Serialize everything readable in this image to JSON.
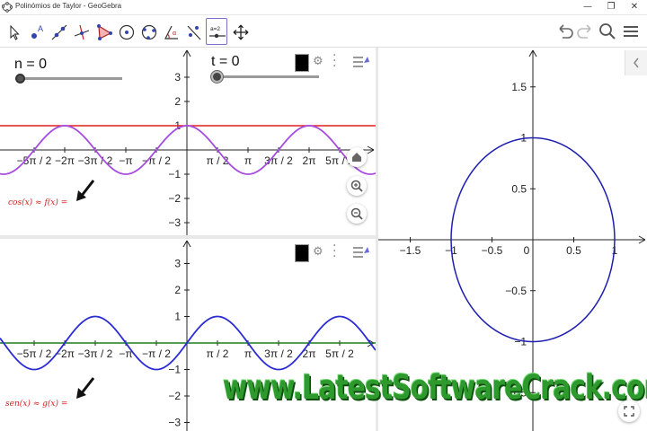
{
  "window": {
    "title": "Polinómios de Taylor - GeoGebra",
    "minimize_glyph": "—",
    "restore_glyph": "❐",
    "close_glyph": "✕"
  },
  "toolbar": {
    "tools": [
      {
        "name": "move-tool-icon"
      },
      {
        "name": "point-tool-icon"
      },
      {
        "name": "line-tool-icon"
      },
      {
        "name": "perpendicular-tool-icon"
      },
      {
        "name": "polygon-tool-icon"
      },
      {
        "name": "circle-tool-icon"
      },
      {
        "name": "conic-tool-icon"
      },
      {
        "name": "angle-tool-icon"
      },
      {
        "name": "reflect-tool-icon"
      },
      {
        "name": "slider-tool-icon",
        "label": "a=2",
        "active": true
      },
      {
        "name": "move-graphics-view-icon"
      }
    ],
    "right": [
      "undo-icon",
      "redo-icon",
      "search-icon",
      "menu-icon"
    ]
  },
  "graphics1": {
    "slider_n_label": "n = 0",
    "slider_t_label": "t = 0",
    "formula": "cos(x) ≈ f(x) =",
    "y_ticks": [
      "3",
      "2",
      "1",
      "−1",
      "−2",
      "−3"
    ],
    "x_ticks": [
      "−5π / 2",
      "−2π",
      "−3π / 2",
      "−π",
      "−π / 2",
      "π / 2",
      "π",
      "3π / 2",
      "2π",
      "5π / 2"
    ],
    "functions": {
      "f": {
        "expression": "1",
        "color": "#e02020"
      },
      "cos": {
        "expression": "cos(x)",
        "color": "#a64ce0"
      }
    }
  },
  "graphics2": {
    "formula": "sen(x) ≈ g(x) =",
    "y_ticks": [
      "3",
      "2",
      "1",
      "−1",
      "−2",
      "−3"
    ],
    "x_ticks": [
      "−5π / 2",
      "−2π",
      "−3π / 2",
      "−π",
      "−π / 2",
      "π / 2",
      "π",
      "3π / 2",
      "2π",
      "5π / 2"
    ],
    "functions": {
      "g": {
        "expression": "0",
        "color": "#1e7a1e"
      },
      "sin": {
        "expression": "sin(x)",
        "color": "#2b2bd6"
      }
    }
  },
  "graphics3": {
    "x_ticks": [
      "−1.5",
      "−1",
      "−0.5",
      "0",
      "0.5",
      "1"
    ],
    "y_ticks": [
      "1.5",
      "1",
      "0.5",
      "−0.5",
      "−1",
      "−1.5"
    ],
    "circle": {
      "center": [
        0,
        0
      ],
      "radius": 1,
      "color": "#2020b0"
    }
  },
  "watermark": "www.LatestSoftwareCrack.com",
  "colors": {
    "accent": "#7a6fd0",
    "red": "#e02020",
    "purple": "#a64ce0",
    "blue": "#2b2bd6",
    "green": "#1e7a1e",
    "circle": "#2020b0"
  }
}
